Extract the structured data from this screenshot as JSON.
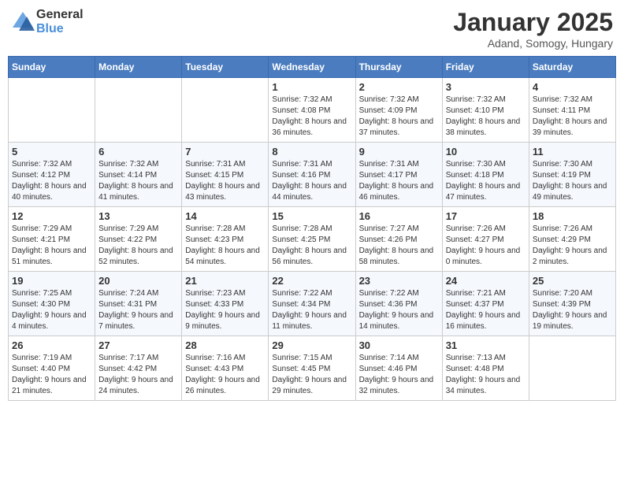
{
  "header": {
    "logo_line1": "General",
    "logo_line2": "Blue",
    "main_title": "January 2025",
    "subtitle": "Adand, Somogy, Hungary"
  },
  "days_of_week": [
    "Sunday",
    "Monday",
    "Tuesday",
    "Wednesday",
    "Thursday",
    "Friday",
    "Saturday"
  ],
  "weeks": [
    [
      {
        "day": "",
        "info": ""
      },
      {
        "day": "",
        "info": ""
      },
      {
        "day": "",
        "info": ""
      },
      {
        "day": "1",
        "info": "Sunrise: 7:32 AM\nSunset: 4:08 PM\nDaylight: 8 hours and 36 minutes."
      },
      {
        "day": "2",
        "info": "Sunrise: 7:32 AM\nSunset: 4:09 PM\nDaylight: 8 hours and 37 minutes."
      },
      {
        "day": "3",
        "info": "Sunrise: 7:32 AM\nSunset: 4:10 PM\nDaylight: 8 hours and 38 minutes."
      },
      {
        "day": "4",
        "info": "Sunrise: 7:32 AM\nSunset: 4:11 PM\nDaylight: 8 hours and 39 minutes."
      }
    ],
    [
      {
        "day": "5",
        "info": "Sunrise: 7:32 AM\nSunset: 4:12 PM\nDaylight: 8 hours and 40 minutes."
      },
      {
        "day": "6",
        "info": "Sunrise: 7:32 AM\nSunset: 4:14 PM\nDaylight: 8 hours and 41 minutes."
      },
      {
        "day": "7",
        "info": "Sunrise: 7:31 AM\nSunset: 4:15 PM\nDaylight: 8 hours and 43 minutes."
      },
      {
        "day": "8",
        "info": "Sunrise: 7:31 AM\nSunset: 4:16 PM\nDaylight: 8 hours and 44 minutes."
      },
      {
        "day": "9",
        "info": "Sunrise: 7:31 AM\nSunset: 4:17 PM\nDaylight: 8 hours and 46 minutes."
      },
      {
        "day": "10",
        "info": "Sunrise: 7:30 AM\nSunset: 4:18 PM\nDaylight: 8 hours and 47 minutes."
      },
      {
        "day": "11",
        "info": "Sunrise: 7:30 AM\nSunset: 4:19 PM\nDaylight: 8 hours and 49 minutes."
      }
    ],
    [
      {
        "day": "12",
        "info": "Sunrise: 7:29 AM\nSunset: 4:21 PM\nDaylight: 8 hours and 51 minutes."
      },
      {
        "day": "13",
        "info": "Sunrise: 7:29 AM\nSunset: 4:22 PM\nDaylight: 8 hours and 52 minutes."
      },
      {
        "day": "14",
        "info": "Sunrise: 7:28 AM\nSunset: 4:23 PM\nDaylight: 8 hours and 54 minutes."
      },
      {
        "day": "15",
        "info": "Sunrise: 7:28 AM\nSunset: 4:25 PM\nDaylight: 8 hours and 56 minutes."
      },
      {
        "day": "16",
        "info": "Sunrise: 7:27 AM\nSunset: 4:26 PM\nDaylight: 8 hours and 58 minutes."
      },
      {
        "day": "17",
        "info": "Sunrise: 7:26 AM\nSunset: 4:27 PM\nDaylight: 9 hours and 0 minutes."
      },
      {
        "day": "18",
        "info": "Sunrise: 7:26 AM\nSunset: 4:29 PM\nDaylight: 9 hours and 2 minutes."
      }
    ],
    [
      {
        "day": "19",
        "info": "Sunrise: 7:25 AM\nSunset: 4:30 PM\nDaylight: 9 hours and 4 minutes."
      },
      {
        "day": "20",
        "info": "Sunrise: 7:24 AM\nSunset: 4:31 PM\nDaylight: 9 hours and 7 minutes."
      },
      {
        "day": "21",
        "info": "Sunrise: 7:23 AM\nSunset: 4:33 PM\nDaylight: 9 hours and 9 minutes."
      },
      {
        "day": "22",
        "info": "Sunrise: 7:22 AM\nSunset: 4:34 PM\nDaylight: 9 hours and 11 minutes."
      },
      {
        "day": "23",
        "info": "Sunrise: 7:22 AM\nSunset: 4:36 PM\nDaylight: 9 hours and 14 minutes."
      },
      {
        "day": "24",
        "info": "Sunrise: 7:21 AM\nSunset: 4:37 PM\nDaylight: 9 hours and 16 minutes."
      },
      {
        "day": "25",
        "info": "Sunrise: 7:20 AM\nSunset: 4:39 PM\nDaylight: 9 hours and 19 minutes."
      }
    ],
    [
      {
        "day": "26",
        "info": "Sunrise: 7:19 AM\nSunset: 4:40 PM\nDaylight: 9 hours and 21 minutes."
      },
      {
        "day": "27",
        "info": "Sunrise: 7:17 AM\nSunset: 4:42 PM\nDaylight: 9 hours and 24 minutes."
      },
      {
        "day": "28",
        "info": "Sunrise: 7:16 AM\nSunset: 4:43 PM\nDaylight: 9 hours and 26 minutes."
      },
      {
        "day": "29",
        "info": "Sunrise: 7:15 AM\nSunset: 4:45 PM\nDaylight: 9 hours and 29 minutes."
      },
      {
        "day": "30",
        "info": "Sunrise: 7:14 AM\nSunset: 4:46 PM\nDaylight: 9 hours and 32 minutes."
      },
      {
        "day": "31",
        "info": "Sunrise: 7:13 AM\nSunset: 4:48 PM\nDaylight: 9 hours and 34 minutes."
      },
      {
        "day": "",
        "info": ""
      }
    ]
  ]
}
